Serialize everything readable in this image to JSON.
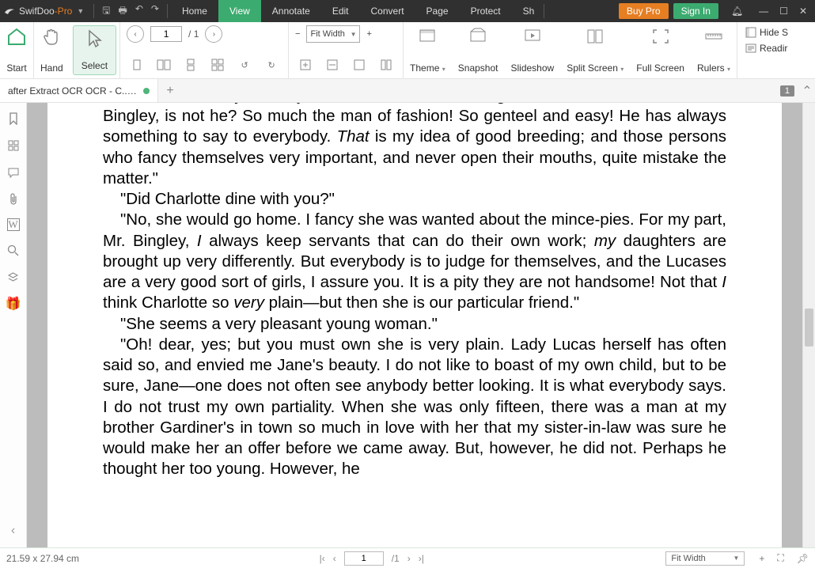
{
  "app": {
    "name_a": "SwifDoo",
    "name_b": "-Pro"
  },
  "qat": {
    "save": "💾",
    "print": "🖶",
    "undo": "↶",
    "redo": "↷"
  },
  "menus": [
    "Home",
    "View",
    "Annotate",
    "Edit",
    "Convert",
    "Page",
    "Protect",
    "Sh"
  ],
  "menu_active": 1,
  "buttons": {
    "buypro": "Buy Pro",
    "signin": "Sign In"
  },
  "ribbon": {
    "start": "Start",
    "hand": "Hand",
    "select": "Select",
    "page_current": "1",
    "page_total": "/ 1",
    "fit": "Fit Width",
    "theme": "Theme",
    "snapshot": "Snapshot",
    "slideshow": "Slideshow",
    "split": "Split Screen",
    "full": "Full Screen",
    "rulers": "Rulers",
    "hide": "Hide S",
    "reading": "Readir"
  },
  "tab": {
    "title": "after Extract OCR OCR - C....pdf"
  },
  "tab_badge": "1",
  "document": {
    "p1": "Yes, she called yesterday with her father. What an agreeable man Sir William is, Mr. Bingley, is not he? So much the man of fashion! So genteel and easy! He has always something to say to everybody. ",
    "p1_em": "That",
    "p1b": " is my idea of good breeding; and those persons who fancy themselves very important, and never open their mouths, quite mistake the matter.\"",
    "p2": "\"Did Charlotte dine with you?\"",
    "p3a": "\"No, she would go home. I fancy she was wanted about the mince-pies. For my part, Mr. Bingley, ",
    "p3_em1": "I",
    "p3b": " always keep servants that can do their own work; ",
    "p3_em2": "my",
    "p3c": " daughters are brought up very differently. But everybody is to judge for themselves, and the Lucases are a very good sort of girls, I assure you. It is a pity they are not handsome! Not that ",
    "p3_em3": "I",
    "p3d": " think Charlotte so ",
    "p3_em4": "very",
    "p3e": " plain—but then she is our particular friend.\"",
    "p4": "\"She seems a very pleasant young woman.\"",
    "p5": "\"Oh! dear, yes; but you must own she is very plain. Lady Lucas herself has often said so, and envied me Jane's beauty. I do not like to boast of my own child, but to be sure, Jane—one does not often see anybody better looking. It is what everybody says. I do not trust my own partiality. When she was only fifteen, there was a man at my brother Gardiner's in town so much in love with her that my sister-in-law was sure he would make her an offer before we came away. But, however, he did not. Perhaps he thought her too young. However, he"
  },
  "status": {
    "dim": "21.59 x 27.94 cm",
    "page": "1",
    "total": "/1",
    "fit": "Fit Width"
  }
}
